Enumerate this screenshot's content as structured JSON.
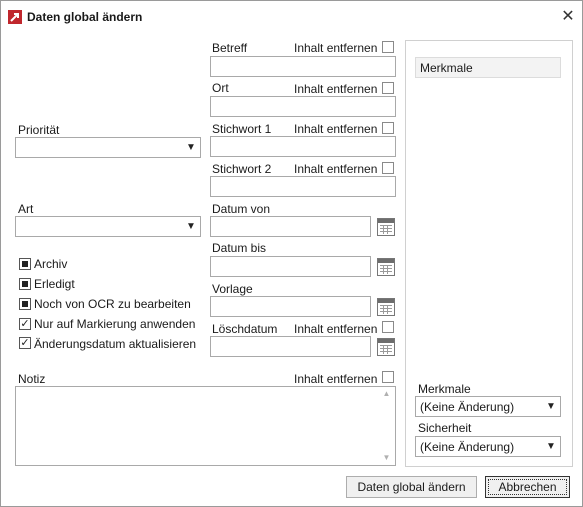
{
  "window": {
    "title": "Daten global ändern",
    "close_glyph": "✕",
    "icon": "app-logo-icon",
    "accent_color": "#c0272d"
  },
  "fields": {
    "betreff": {
      "label": "Betreff",
      "clear_label": "Inhalt entfernen",
      "value": "",
      "clear_checked": false
    },
    "ort": {
      "label": "Ort",
      "clear_label": "Inhalt entfernen",
      "value": "",
      "clear_checked": false
    },
    "stichwort1": {
      "label": "Stichwort 1",
      "clear_label": "Inhalt entfernen",
      "value": "",
      "clear_checked": false
    },
    "stichwort2": {
      "label": "Stichwort 2",
      "clear_label": "Inhalt entfernen",
      "value": "",
      "clear_checked": false
    },
    "datum_von": {
      "label": "Datum von",
      "value": ""
    },
    "datum_bis": {
      "label": "Datum bis",
      "value": ""
    },
    "vorlage": {
      "label": "Vorlage",
      "value": ""
    },
    "loeschdatum": {
      "label": "Löschdatum",
      "clear_label": "Inhalt entfernen",
      "value": "",
      "clear_checked": false
    }
  },
  "left": {
    "prioritaet": {
      "label": "Priorität",
      "value": ""
    },
    "art": {
      "label": "Art",
      "value": ""
    },
    "checkboxes": [
      {
        "label": "Archiv",
        "state": "indeterminate"
      },
      {
        "label": "Erledigt",
        "state": "indeterminate"
      },
      {
        "label": "Noch von OCR zu bearbeiten",
        "state": "indeterminate"
      },
      {
        "label": "Nur auf Markierung anwenden",
        "state": "checked"
      },
      {
        "label": "Änderungsdatum aktualisieren",
        "state": "checked"
      }
    ]
  },
  "notiz": {
    "label": "Notiz",
    "clear_label": "Inhalt entfernen",
    "value": "",
    "clear_checked": false
  },
  "right_panel": {
    "header": "Merkmale",
    "merkmale": {
      "label": "Merkmale",
      "value": "(Keine Änderung)"
    },
    "sicherheit": {
      "label": "Sicherheit",
      "value": "(Keine Änderung)"
    }
  },
  "buttons": {
    "apply": "Daten global ändern",
    "cancel": "Abbrechen"
  },
  "glyphs": {
    "dropdown": "▼",
    "check": "✓",
    "scroll_up": "▲",
    "scroll_down": "▼"
  }
}
